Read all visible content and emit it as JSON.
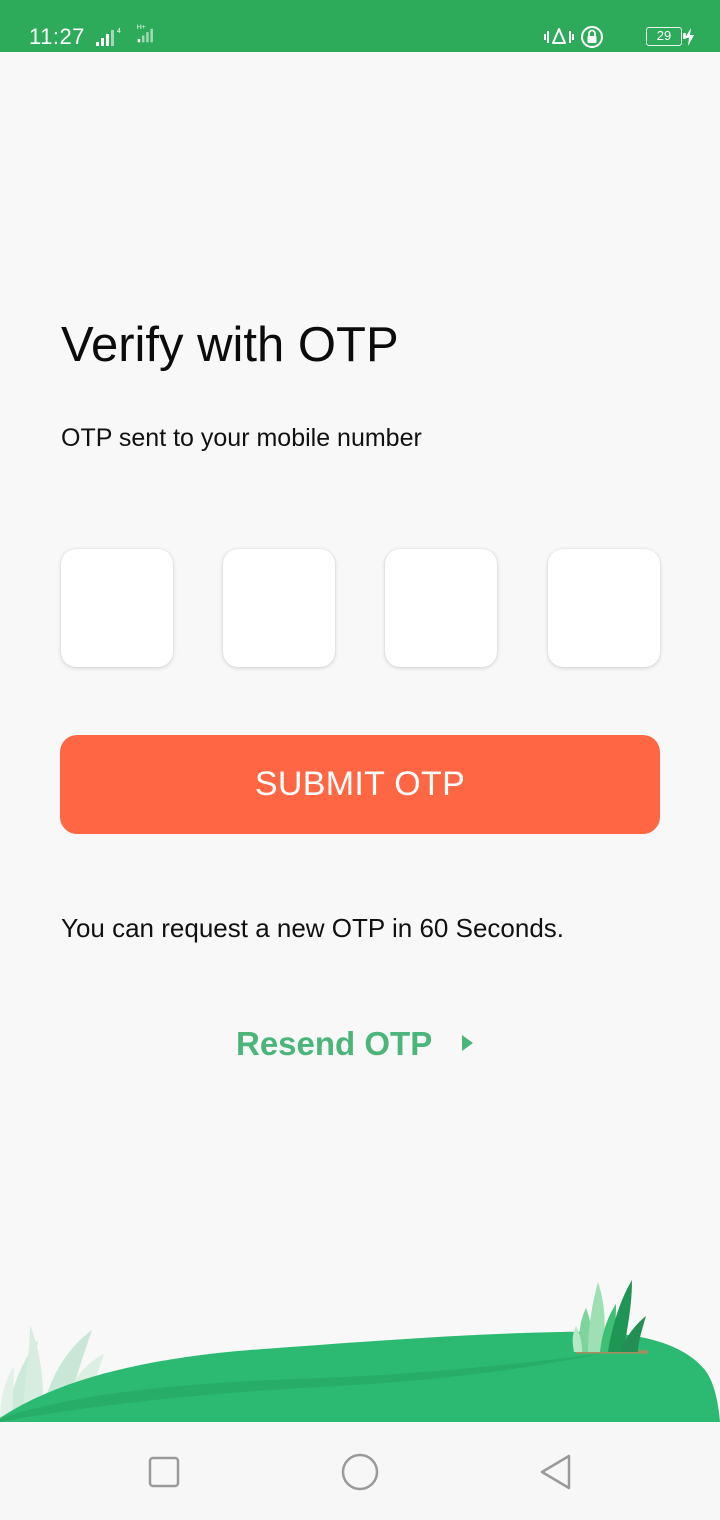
{
  "status_bar": {
    "time": "11:27",
    "network_badge": "H+",
    "battery": "29",
    "icons": [
      "signal-icon",
      "signal-icon",
      "vibrate-icon",
      "rotation-lock-icon",
      "battery-icon",
      "charging-icon"
    ],
    "background": "#2eab5a"
  },
  "page": {
    "title": "Verify with OTP",
    "subtitle": "OTP sent to your mobile number",
    "otp_inputs": [
      {
        "value": ""
      },
      {
        "value": ""
      },
      {
        "value": ""
      },
      {
        "value": ""
      }
    ],
    "submit_label": "SUBMIT OTP",
    "timer_text": "You can request a new OTP in 60 Seconds.",
    "resend_label": "Resend OTP",
    "resend_icon": "play-arrow-icon"
  },
  "colors": {
    "accent_green": "#4cb57a",
    "submit_orange": "#ff6643",
    "grass_green": "#2cba72",
    "background": "#f8f8f8"
  },
  "nav_bar": {
    "icons": [
      "recents-square-icon",
      "home-circle-icon",
      "back-triangle-icon"
    ]
  }
}
